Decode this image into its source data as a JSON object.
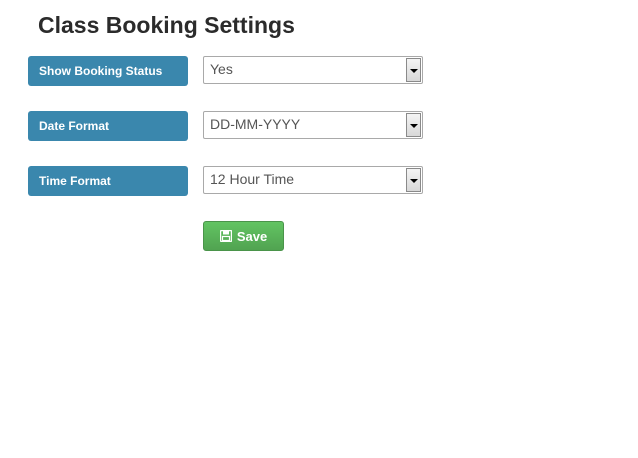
{
  "page": {
    "title": "Class Booking Settings"
  },
  "settings": [
    {
      "label": "Show Booking Status",
      "value": "Yes"
    },
    {
      "label": "Date Format",
      "value": "DD-MM-YYYY"
    },
    {
      "label": "Time Format",
      "value": "12 Hour Time"
    }
  ],
  "actions": {
    "save_label": "Save",
    "save_icon": "floppy-disk-icon"
  },
  "colors": {
    "label_background": "#3a87ad",
    "save_button": "#5bb75b"
  }
}
